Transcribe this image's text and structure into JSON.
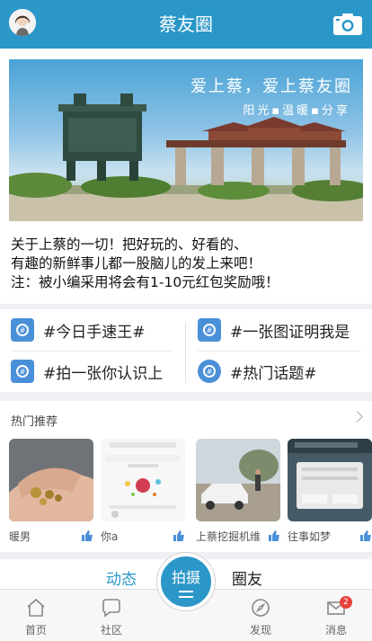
{
  "header": {
    "title": "蔡友圈"
  },
  "banner": {
    "title": "爱上蔡，爱上蔡友圈",
    "subtitle": "阳光▪温暖▪分享"
  },
  "intro": {
    "line1": "关于上蔡的一切！把好玩的、好看的、",
    "line2": "有趣的新鲜事儿都一股脑儿的发上来吧！",
    "line3": "注：被小编采用将会有1-10元红包奖励哦！"
  },
  "topics": [
    {
      "label": "#今日手速王#"
    },
    {
      "label": "#一张图证明我是"
    },
    {
      "label": "#拍一张你认识上"
    },
    {
      "label": "#热门话题#"
    }
  ],
  "recommend": {
    "title": "热门推荐",
    "cards": [
      {
        "caption": "暖男"
      },
      {
        "caption": "你a"
      },
      {
        "caption": "上蔡挖掘机维"
      },
      {
        "caption": "往事如梦"
      }
    ]
  },
  "tabs": {
    "active": "动态",
    "other": "圈友"
  },
  "bottom_nav": {
    "home": "首页",
    "community": "社区",
    "shoot": "拍摄",
    "discover": "发现",
    "messages": "消息",
    "message_badge": "2"
  },
  "colors": {
    "accent": "#2b97c9",
    "badge": "#e8413b",
    "topic_tag": "#4a90d9"
  }
}
